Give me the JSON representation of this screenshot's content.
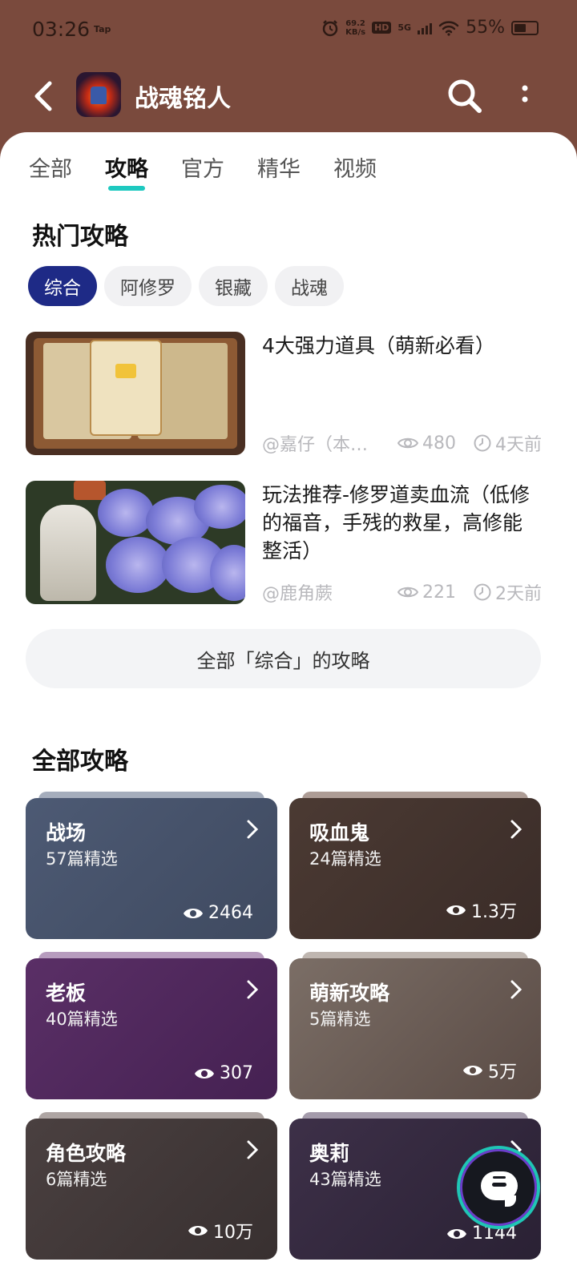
{
  "status_bar": {
    "time": "03:26",
    "tap_label": "Tap",
    "net_speed_value": "69.2",
    "net_speed_unit": "KB/s",
    "hd_label": "HD",
    "network": "5G",
    "battery": "55%"
  },
  "header": {
    "title": "战魂铭人"
  },
  "tabs": [
    {
      "label": "全部"
    },
    {
      "label": "攻略"
    },
    {
      "label": "官方"
    },
    {
      "label": "精华"
    },
    {
      "label": "视频"
    }
  ],
  "hot": {
    "title": "热门攻略",
    "chips": [
      {
        "label": "综合"
      },
      {
        "label": "阿修罗"
      },
      {
        "label": "银藏"
      },
      {
        "label": "战魂"
      }
    ],
    "guides": [
      {
        "title": "4大强力道具（萌新必看）",
        "author": "@嘉仔（本…",
        "views": "480",
        "time": "4天前"
      },
      {
        "title": "玩法推荐-修罗道卖血流（低修的福音，手残的救星，高修能整活）",
        "author": "@鹿角蕨",
        "views": "221",
        "time": "2天前"
      }
    ],
    "all_button": "全部「综合」的攻略"
  },
  "all": {
    "title": "全部攻略",
    "categories": [
      {
        "name": "战场",
        "count": "57篇精选",
        "views": "2464"
      },
      {
        "name": "吸血鬼",
        "count": "24篇精选",
        "views": "1.3万"
      },
      {
        "name": "老板",
        "count": "40篇精选",
        "views": "307"
      },
      {
        "name": "萌新攻略",
        "count": "5篇精选",
        "views": "5万"
      },
      {
        "name": "角色攻略",
        "count": "6篇精选",
        "views": "10万"
      },
      {
        "name": "奥莉",
        "count": "43篇精选",
        "views": "1144"
      }
    ]
  }
}
